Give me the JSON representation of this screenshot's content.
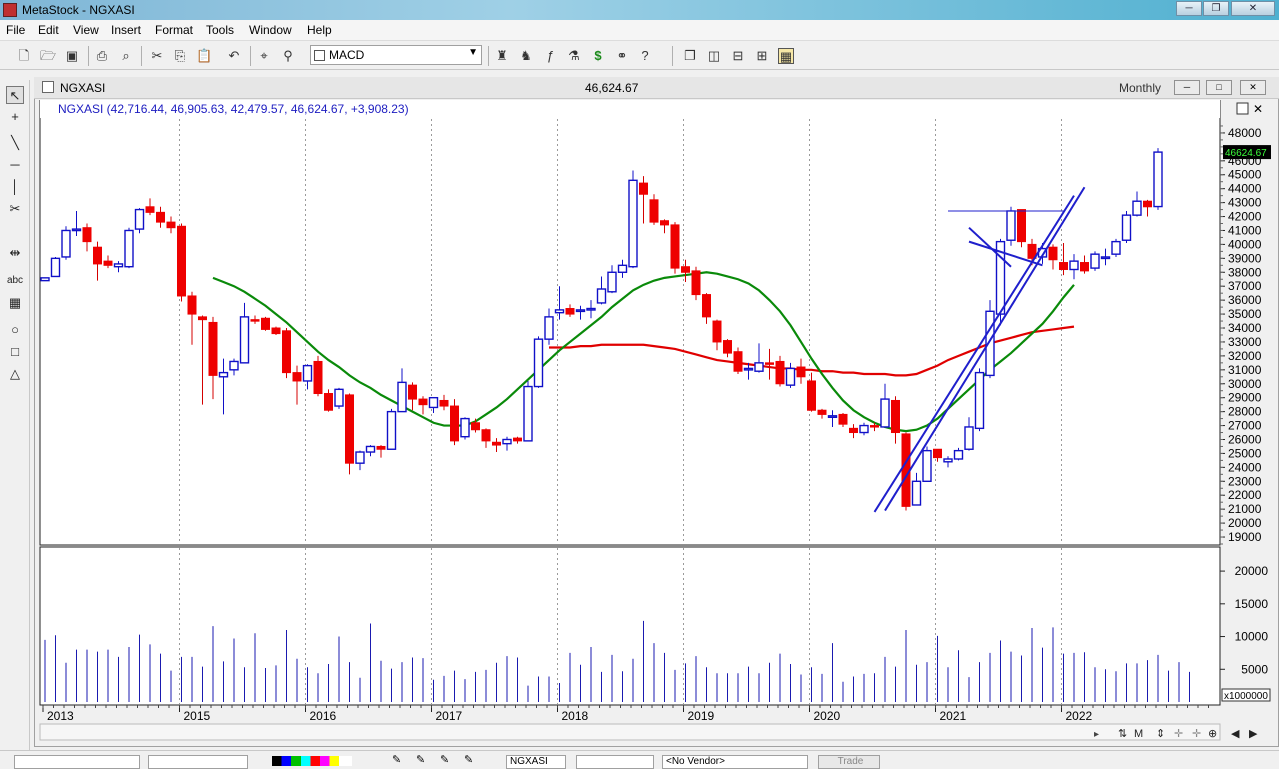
{
  "app": {
    "title": "MetaStock - NGXASI",
    "window_buttons": [
      "─",
      "❐",
      "✕"
    ]
  },
  "menu": [
    "File",
    "Edit",
    "View",
    "Insert",
    "Format",
    "Tools",
    "Window",
    "Help"
  ],
  "toolbar": {
    "indicator_value": "MACD"
  },
  "chart_window": {
    "symbol": "NGXASI",
    "last_price": "46,624.67",
    "periodicity": "Monthly",
    "legend": "NGXASI (42,716.44, 46,905.63, 42,479.57, 46,624.67, +3,908.23)",
    "last_label": "46624.67"
  },
  "chart_data": {
    "type": "candlestick",
    "y_ticks": [
      19000,
      20000,
      21000,
      22000,
      23000,
      24000,
      25000,
      26000,
      27000,
      28000,
      29000,
      30000,
      31000,
      32000,
      33000,
      34000,
      35000,
      36000,
      37000,
      38000,
      39000,
      40000,
      41000,
      42000,
      43000,
      44000,
      45000,
      46000,
      48000
    ],
    "ylim": [
      18500,
      49000
    ],
    "year_labels": [
      "2013",
      "2015",
      "2016",
      "2017",
      "2018",
      "2019",
      "2020",
      "2021",
      "2022"
    ],
    "year_label_month_index": [
      0,
      13,
      25,
      37,
      49,
      61,
      73,
      85,
      97
    ],
    "candles": [
      [
        37400,
        37600,
        37400,
        37600
      ],
      [
        37700,
        39100,
        37700,
        39000
      ],
      [
        39100,
        41300,
        38900,
        41000
      ],
      [
        41000,
        42400,
        40600,
        41100
      ],
      [
        41200,
        41500,
        39500,
        40200
      ],
      [
        39800,
        40200,
        37400,
        38600
      ],
      [
        38800,
        39200,
        38300,
        38500
      ],
      [
        38400,
        38800,
        38000,
        38600
      ],
      [
        38400,
        41200,
        38300,
        41000
      ],
      [
        41100,
        42600,
        40800,
        42500
      ],
      [
        42700,
        43300,
        42100,
        42300
      ],
      [
        42300,
        42700,
        41200,
        41600
      ],
      [
        41600,
        42000,
        40800,
        41200
      ],
      [
        41300,
        41500,
        35900,
        36300
      ],
      [
        36300,
        36600,
        32800,
        35000
      ],
      [
        34800,
        34900,
        28500,
        34600
      ],
      [
        34400,
        34800,
        28900,
        30600
      ],
      [
        30500,
        31800,
        27800,
        30800
      ],
      [
        31000,
        31800,
        30600,
        31600
      ],
      [
        31500,
        35800,
        31600,
        34800
      ],
      [
        34600,
        34900,
        34300,
        34500
      ],
      [
        34700,
        34800,
        33800,
        33900
      ],
      [
        34000,
        34100,
        33500,
        33600
      ],
      [
        33800,
        34000,
        30400,
        30800
      ],
      [
        30800,
        31300,
        28500,
        30200
      ],
      [
        30200,
        31400,
        29600,
        31300
      ],
      [
        31600,
        32000,
        29100,
        29300
      ],
      [
        29300,
        29600,
        28000,
        28100
      ],
      [
        28400,
        29700,
        28200,
        29600
      ],
      [
        29200,
        29300,
        23500,
        24300
      ],
      [
        24300,
        25200,
        23800,
        25100
      ],
      [
        25100,
        25600,
        24800,
        25500
      ],
      [
        25500,
        25600,
        24700,
        25300
      ],
      [
        25300,
        28200,
        25400,
        28000
      ],
      [
        28000,
        31100,
        28100,
        30100
      ],
      [
        29900,
        30100,
        28100,
        28900
      ],
      [
        28900,
        29100,
        27800,
        28500
      ],
      [
        28300,
        29000,
        27900,
        29000
      ],
      [
        28800,
        29200,
        28100,
        28400
      ],
      [
        28400,
        28900,
        25600,
        25900
      ],
      [
        26200,
        27600,
        26000,
        27500
      ],
      [
        27200,
        27500,
        26500,
        26700
      ],
      [
        26700,
        26800,
        25400,
        25900
      ],
      [
        25800,
        26100,
        25100,
        25600
      ],
      [
        25700,
        26200,
        25200,
        26000
      ],
      [
        26100,
        26200,
        25700,
        25900
      ],
      [
        25900,
        30200,
        25900,
        29800
      ],
      [
        29800,
        33400,
        29700,
        33200
      ],
      [
        33200,
        35400,
        32800,
        34800
      ],
      [
        35100,
        37000,
        34600,
        35300
      ],
      [
        35400,
        35700,
        34800,
        35000
      ],
      [
        35200,
        35600,
        34600,
        35300
      ],
      [
        35400,
        36000,
        34700,
        35400
      ],
      [
        35800,
        37700,
        35700,
        36800
      ],
      [
        36600,
        38500,
        36500,
        38000
      ],
      [
        38000,
        38900,
        37600,
        38500
      ],
      [
        38400,
        45300,
        38300,
        44600
      ],
      [
        44400,
        44900,
        41500,
        43600
      ],
      [
        43200,
        43600,
        41400,
        41600
      ],
      [
        41700,
        41800,
        40800,
        41400
      ],
      [
        41400,
        41600,
        37900,
        38300
      ],
      [
        38400,
        38900,
        37300,
        38000
      ],
      [
        38100,
        38400,
        36000,
        36400
      ],
      [
        36400,
        36500,
        34300,
        34800
      ],
      [
        34500,
        34600,
        32400,
        33000
      ],
      [
        33100,
        33200,
        31900,
        32200
      ],
      [
        32300,
        32600,
        30700,
        30900
      ],
      [
        31000,
        31500,
        30300,
        31100
      ],
      [
        30900,
        32900,
        30800,
        31500
      ],
      [
        31500,
        32500,
        30300,
        31400
      ],
      [
        31600,
        32000,
        29800,
        30000
      ],
      [
        29900,
        31500,
        29700,
        31100
      ],
      [
        31200,
        31800,
        30000,
        30500
      ],
      [
        30200,
        30800,
        28000,
        28100
      ],
      [
        28100,
        28200,
        27500,
        27800
      ],
      [
        27700,
        28100,
        26900,
        27700
      ],
      [
        27800,
        27900,
        26900,
        27100
      ],
      [
        26800,
        27100,
        26100,
        26500
      ],
      [
        26500,
        27200,
        26300,
        27000
      ],
      [
        27000,
        27200,
        26600,
        26900
      ],
      [
        26900,
        30000,
        26900,
        28900
      ],
      [
        28800,
        29100,
        25700,
        26500
      ],
      [
        26400,
        26500,
        20900,
        21200
      ],
      [
        21300,
        23600,
        21300,
        23000
      ],
      [
        23000,
        25500,
        23100,
        25200
      ],
      [
        25300,
        25300,
        24400,
        24700
      ],
      [
        24400,
        24800,
        24000,
        24600
      ],
      [
        24600,
        25400,
        24500,
        25200
      ],
      [
        25300,
        27600,
        25200,
        26900
      ],
      [
        26800,
        31100,
        26600,
        30800
      ],
      [
        30600,
        36000,
        30400,
        35200
      ],
      [
        35000,
        40400,
        34200,
        40200
      ],
      [
        40300,
        42700,
        39900,
        42400
      ],
      [
        42500,
        42500,
        39800,
        40200
      ],
      [
        40000,
        40400,
        38500,
        39000
      ],
      [
        39100,
        40100,
        38600,
        39700
      ],
      [
        39800,
        40000,
        38200,
        38900
      ],
      [
        38700,
        40100,
        37800,
        38200
      ],
      [
        38200,
        39300,
        37500,
        38800
      ],
      [
        38700,
        39200,
        37900,
        38100
      ],
      [
        38300,
        39500,
        38100,
        39300
      ],
      [
        39000,
        39700,
        38500,
        39100
      ],
      [
        39300,
        40400,
        39100,
        40200
      ],
      [
        40300,
        42400,
        40100,
        42100
      ],
      [
        42100,
        43800,
        42000,
        43100
      ],
      [
        43100,
        43200,
        42000,
        42700
      ],
      [
        42716,
        46906,
        42480,
        46625
      ]
    ],
    "volume_ticks": [
      5000,
      10000,
      15000,
      20000
    ],
    "volume_unit_label": "x1000000",
    "volumes": [
      9500,
      10200,
      6000,
      8000,
      8000,
      7700,
      8000,
      6900,
      8400,
      10300,
      8800,
      7400,
      4800,
      6900,
      6900,
      5400,
      11600,
      6200,
      9700,
      5300,
      10500,
      5200,
      5600,
      11000,
      6600,
      5300,
      4400,
      5800,
      10000,
      6100,
      3700,
      12000,
      6300,
      5100,
      6100,
      6800,
      6700,
      3400,
      4000,
      4800,
      3500,
      4600,
      4900,
      6000,
      7000,
      6800,
      2500,
      3900,
      3900,
      2900,
      7500,
      5700,
      8400,
      4600,
      7200,
      4700,
      6600,
      12400,
      9000,
      7500,
      4900,
      5900,
      7000,
      5300,
      4400,
      4400,
      4400,
      5400,
      4400,
      6000,
      7400,
      5800,
      4200,
      5300,
      4300,
      9000,
      3100,
      3900,
      4300,
      4400,
      6900,
      5400,
      11000,
      5700,
      6100,
      10100,
      5300,
      7900,
      3800,
      6100,
      7500,
      9400,
      7700,
      7100,
      11300,
      8300,
      11400,
      7400,
      7500,
      7600,
      5300,
      5000,
      4700,
      5900,
      5900,
      6400,
      7200,
      4800,
      6100,
      4600
    ],
    "ma_green_start_index": 16,
    "ma_green": [
      37600,
      37300,
      37000,
      36600,
      36100,
      35600,
      35000,
      34400,
      33700,
      33000,
      32300,
      31700,
      31200,
      30600,
      30100,
      29700,
      29200,
      28800,
      28400,
      28000,
      27600,
      27200,
      27000,
      27000,
      27000,
      27300,
      27800,
      28300,
      28900,
      29600,
      30300,
      31000,
      31700,
      32400,
      33000,
      33600,
      34200,
      34800,
      35500,
      36100,
      36700,
      37100,
      37400,
      37600,
      37700,
      37800,
      37900,
      38000,
      37900,
      37700,
      37500,
      37200,
      36700,
      36000,
      35200,
      34200,
      33000,
      31800,
      30700,
      29700,
      28800,
      28100,
      27600,
      27200,
      26900,
      26700,
      26600,
      26700,
      27000,
      27500,
      28200,
      28900,
      29600,
      30300,
      31000,
      31600,
      32200,
      32900,
      33600,
      34300,
      35200,
      36200,
      37100
    ],
    "ma_red_start_index": 48,
    "ma_red": [
      32600,
      32600,
      32600,
      32700,
      32700,
      32800,
      32800,
      32800,
      32800,
      32800,
      32700,
      32600,
      32500,
      32300,
      32100,
      31900,
      31700,
      31600,
      31500,
      31400,
      31300,
      31200,
      31100,
      31100,
      31000,
      31000,
      30900,
      30900,
      30800,
      30800,
      30700,
      30700,
      30700,
      30600,
      30600,
      30700,
      31000,
      31300,
      31700,
      32000,
      32300,
      32600,
      32900,
      33100,
      33300,
      33500,
      33700,
      33800,
      33900,
      34000,
      34100
    ],
    "trendlines": [
      {
        "from": [
          79,
          20800
        ],
        "to": [
          98,
          43500
        ],
        "color": "#1f1fcc",
        "width": 2
      },
      {
        "from": [
          80,
          20900
        ],
        "to": [
          99,
          44100
        ],
        "color": "#1f1fcc",
        "width": 2
      },
      {
        "from": [
          88,
          41200
        ],
        "to": [
          92,
          38400
        ],
        "color": "#1f1fcc",
        "width": 2
      },
      {
        "from": [
          88,
          40200
        ],
        "to": [
          95,
          38500
        ],
        "color": "#1f1fcc",
        "width": 2
      },
      {
        "from": [
          86,
          42400
        ],
        "to": [
          97,
          42400
        ],
        "color": "#1f1fcc",
        "width": 1
      }
    ]
  },
  "status": {
    "symbol_box": "NGXASI",
    "vendor_box": "<No Vendor>",
    "trade_button": "Trade"
  }
}
